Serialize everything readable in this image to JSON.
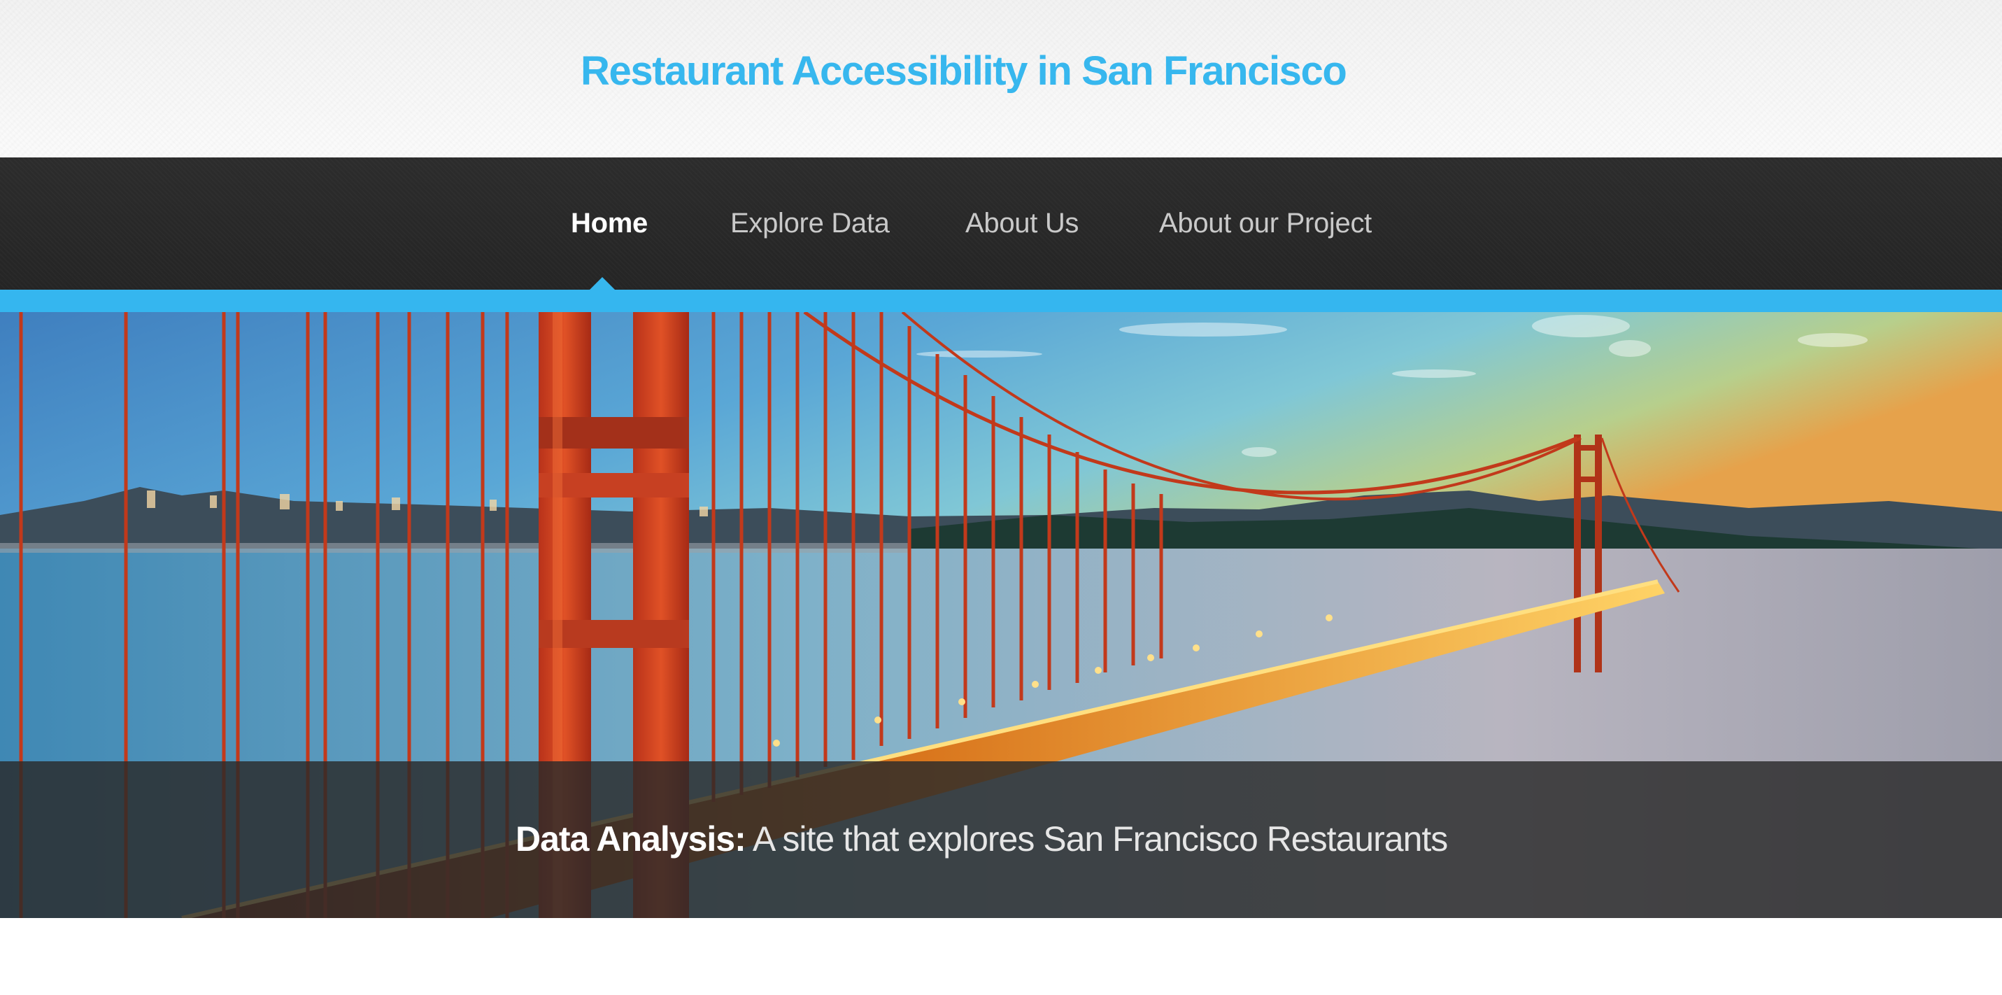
{
  "header": {
    "title": "Restaurant Accessibility in San Francisco"
  },
  "nav": {
    "items": [
      {
        "label": "Home",
        "active": true
      },
      {
        "label": "Explore Data",
        "active": false
      },
      {
        "label": "About Us",
        "active": false
      },
      {
        "label": "About our Project",
        "active": false
      }
    ]
  },
  "hero": {
    "image_alt": "Golden Gate Bridge at dusk with San Francisco skyline",
    "caption_bold": "Data Analysis:",
    "caption_text": " A site that explores San Francisco Restaurants"
  },
  "colors": {
    "accent": "#37b7ee",
    "nav_bg": "#2a2a2a",
    "bridge": "#c63a1b"
  }
}
